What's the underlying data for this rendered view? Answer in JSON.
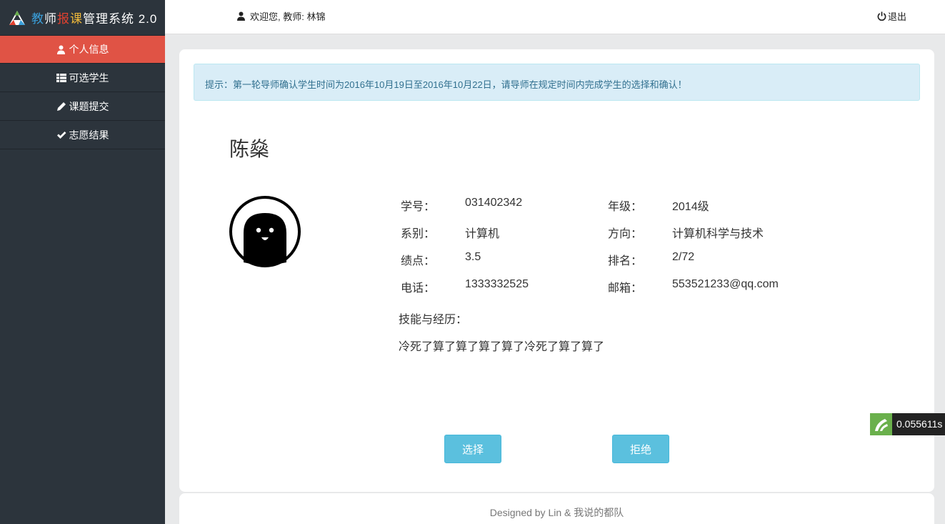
{
  "brand": {
    "parts": [
      "教",
      "师",
      "报",
      "课",
      "管理系统 2.0"
    ],
    "colors": [
      "#3aa0dc",
      "#ffffff",
      "#e2412f",
      "#f0b93a",
      "#ffffff"
    ]
  },
  "sidebar": {
    "items": [
      {
        "label": "个人信息",
        "icon": "user-icon",
        "active": true
      },
      {
        "label": "可选学生",
        "icon": "list-icon",
        "active": false
      },
      {
        "label": "课题提交",
        "icon": "pencil-icon",
        "active": false
      },
      {
        "label": "志愿结果",
        "icon": "check-icon",
        "active": false
      }
    ]
  },
  "header": {
    "welcome": "欢迎您, 教师: 林锦",
    "logout": "退出"
  },
  "notice": "提示：第一轮导师确认学生时间为2016年10月19日至2016年10月22日，请导师在规定时间内完成学生的选择和确认！",
  "student": {
    "name": "陈燊",
    "fields": [
      {
        "label": "学号：",
        "value": "031402342"
      },
      {
        "label": "年级：",
        "value": "2014级"
      },
      {
        "label": "系别：",
        "value": "计算机"
      },
      {
        "label": "方向：",
        "value": "计算机科学与技术"
      },
      {
        "label": "绩点：",
        "value": "3.5"
      },
      {
        "label": "排名：",
        "value": "2/72"
      },
      {
        "label": "电话：",
        "value": "1333332525"
      },
      {
        "label": "邮箱：",
        "value": "553521233@qq.com"
      }
    ],
    "skills_label": "技能与经历：",
    "skills_text": "冷死了算了算了算了算了冷死了算了算了"
  },
  "actions": {
    "select": "选择",
    "reject": "拒绝"
  },
  "footer": "Designed by Lin & 我说的都队",
  "timer": "0.055611s",
  "colors": {
    "sidebar_bg": "#2c343c",
    "active_nav": "#e05345",
    "notice_bg": "#d9edf7",
    "notice_text": "#31708f",
    "button": "#5bc0de"
  }
}
